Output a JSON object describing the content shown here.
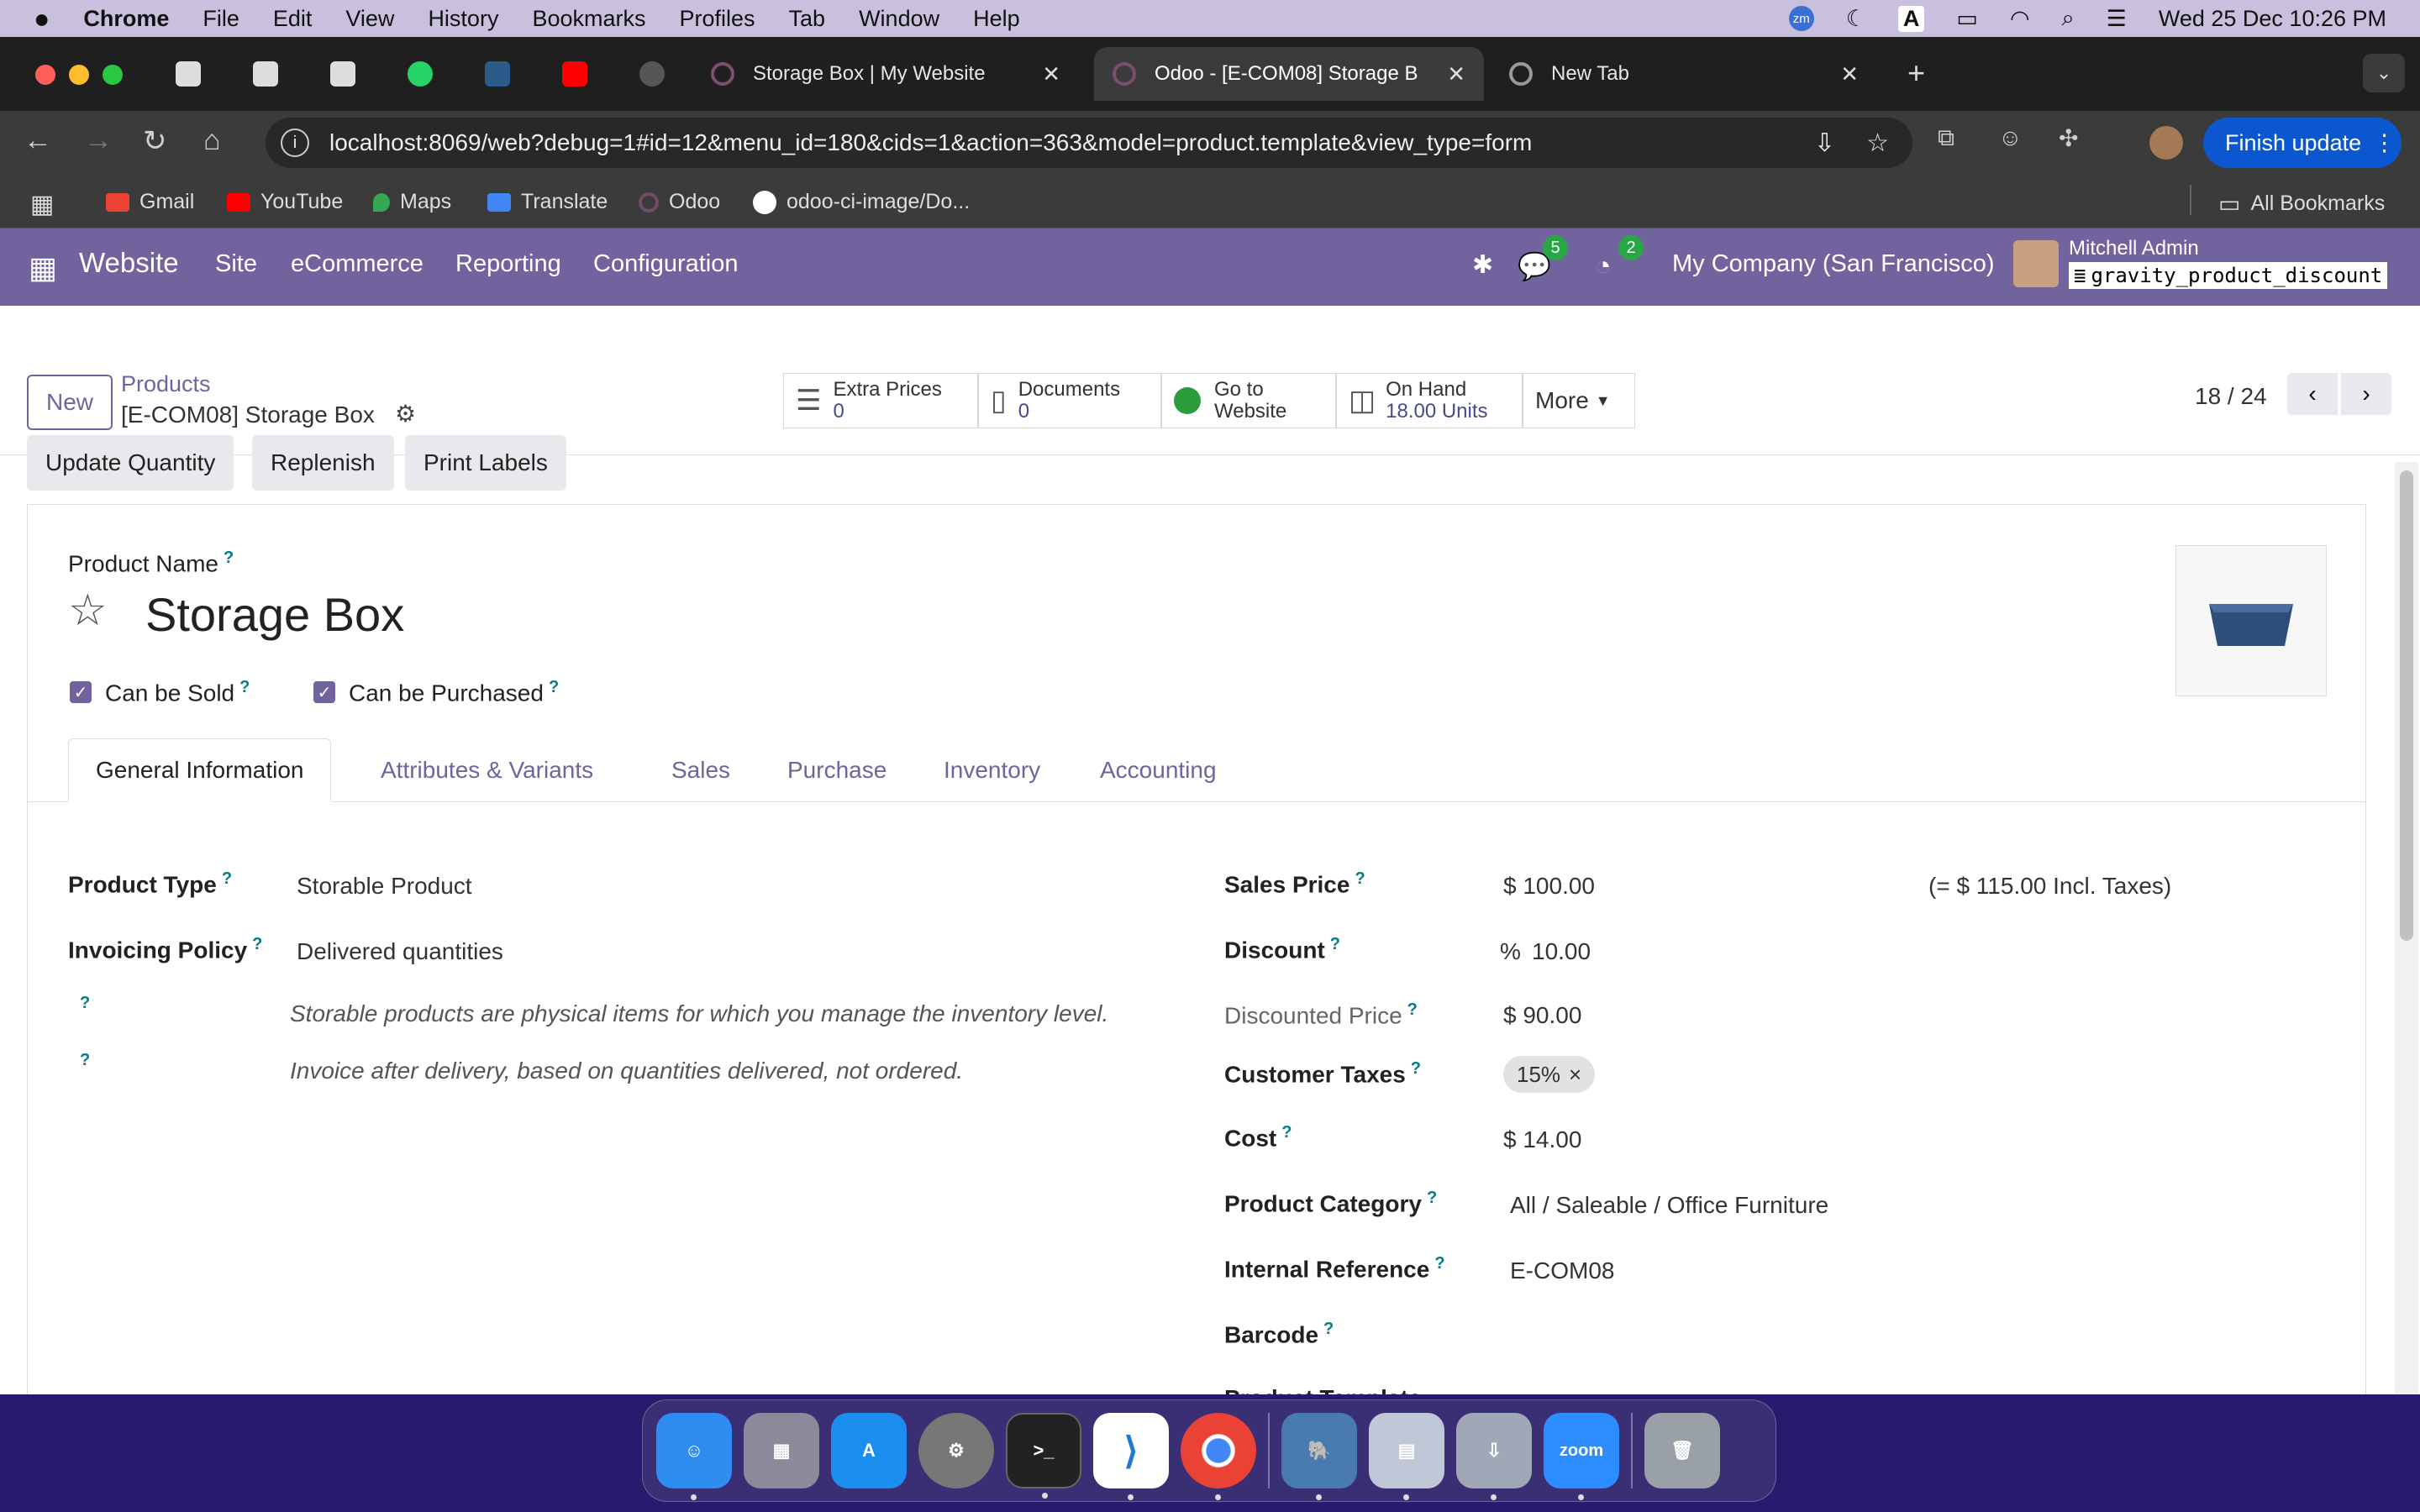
{
  "menubar": {
    "app": "Chrome",
    "items": [
      "File",
      "Edit",
      "View",
      "History",
      "Bookmarks",
      "Profiles",
      "Tab",
      "Window",
      "Help"
    ],
    "clock": "Wed 25 Dec  10:26 PM"
  },
  "tabs": [
    {
      "title": "Storage Box | My Website"
    },
    {
      "title": "Odoo - [E-COM08] Storage B"
    },
    {
      "title": "New Tab"
    }
  ],
  "address": {
    "url": "localhost:8069/web?debug=1#id=12&menu_id=180&cids=1&action=363&model=product.template&view_type=form"
  },
  "finish_update": "Finish update",
  "bookmarks": [
    {
      "label": "Gmail",
      "color": "#ea4335"
    },
    {
      "label": "YouTube",
      "color": "#ff0000"
    },
    {
      "label": "Maps",
      "color": "#34a853"
    },
    {
      "label": "Translate",
      "color": "#4285f4"
    },
    {
      "label": "Odoo",
      "color": "#714b67"
    },
    {
      "label": "odoo-ci-image/Do...",
      "color": "#ffffff"
    }
  ],
  "all_bookmarks": "All Bookmarks",
  "odoo_nav": {
    "app": "Website",
    "items": [
      "Site",
      "eCommerce",
      "Reporting",
      "Configuration"
    ],
    "chat_count": "5",
    "activity_count": "2",
    "company": "My Company (San Francisco)",
    "user": "Mitchell Admin",
    "db": "gravity_product_discount"
  },
  "control": {
    "new_label": "New",
    "breadcrumb_parent": "Products",
    "breadcrumb_current": "[E-COM08] Storage Box",
    "pager": "18 / 24",
    "stat_buttons": [
      {
        "label": "Extra Prices",
        "value": "0"
      },
      {
        "label": "Documents",
        "value": "0"
      },
      {
        "label": "Go to",
        "value": "Website"
      },
      {
        "label": "On Hand",
        "value": "18.00 Units"
      }
    ],
    "more": "More"
  },
  "actions": [
    "Update Quantity",
    "Replenish",
    "Print Labels"
  ],
  "form": {
    "name_label": "Product Name",
    "name": "Storage Box",
    "can_be_sold": "Can be Sold",
    "can_be_purchased": "Can be Purchased",
    "notebook_tabs": [
      "General Information",
      "Attributes & Variants",
      "Sales",
      "Purchase",
      "Inventory",
      "Accounting"
    ],
    "left": {
      "product_type_label": "Product Type",
      "product_type": "Storable Product",
      "invoicing_label": "Invoicing Policy",
      "invoicing": "Delivered quantities",
      "help1": "Storable products are physical items for which you manage the inventory level.",
      "help2": "Invoice after delivery, based on quantities delivered, not ordered."
    },
    "right": {
      "sales_price_label": "Sales Price",
      "sales_price": "$ 100.00",
      "incl_taxes": "(= $ 115.00 Incl. Taxes)",
      "discount_label": "Discount",
      "discount_sign": "%",
      "discount": "10.00",
      "discounted_label": "Discounted Price",
      "discounted": "$ 90.00",
      "taxes_label": "Customer Taxes",
      "tax_tag": "15%",
      "cost_label": "Cost",
      "cost": "$ 14.00",
      "category_label": "Product Category",
      "category": "All / Saleable / Office Furniture",
      "ref_label": "Internal Reference",
      "ref": "E-COM08",
      "barcode_label": "Barcode",
      "tags_label": "Product Template Tags"
    }
  },
  "dock": [
    {
      "name": "Finder",
      "color": "#2f8cf0"
    },
    {
      "name": "Launchpad",
      "color": "#8a8a9a"
    },
    {
      "name": "App Store",
      "color": "#1c8ef0"
    },
    {
      "name": "Settings",
      "color": "#777777"
    },
    {
      "name": "Terminal",
      "color": "#222222"
    },
    {
      "name": "VS Code",
      "color": "#1e7ad6"
    },
    {
      "name": "Chrome",
      "color": "#e8e8e8"
    },
    {
      "name": "pgAdmin",
      "color": "#4a7bb0"
    },
    {
      "name": "Preview",
      "color": "#c0c8d8"
    },
    {
      "name": "Downloads",
      "color": "#a0a8b8"
    },
    {
      "name": "zoom",
      "color": "#2d8cff"
    },
    {
      "name": "Trash",
      "color": "#9aa0a8"
    }
  ]
}
